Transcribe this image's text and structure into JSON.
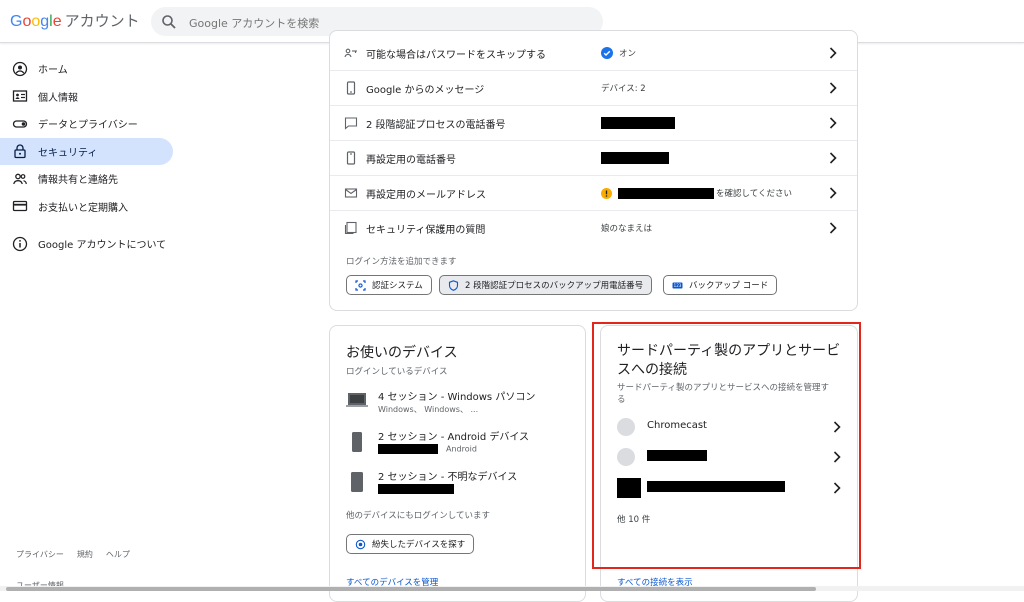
{
  "header": {
    "logo_text": "Google",
    "product_name": "アカウント",
    "search_placeholder": "Google アカウントを検索"
  },
  "sidebar": {
    "items": [
      {
        "label": "ホーム",
        "icon": "home-icon",
        "active": false
      },
      {
        "label": "個人情報",
        "icon": "id-card-icon",
        "active": false
      },
      {
        "label": "データとプライバシー",
        "icon": "toggle-icon",
        "active": false
      },
      {
        "label": "セキュリティ",
        "icon": "lock-icon",
        "active": true
      },
      {
        "label": "情報共有と連絡先",
        "icon": "people-icon",
        "active": false
      },
      {
        "label": "お支払いと定期購入",
        "icon": "credit-card-icon",
        "active": false
      }
    ],
    "about": {
      "label": "Google アカウントについて",
      "icon": "info-icon"
    },
    "footer_links": [
      "プライバシー",
      "規約",
      "ヘルプ"
    ],
    "user_info": "ユーザー情報"
  },
  "signin_methods": {
    "rows": [
      {
        "label": "可能な場合はパスワードをスキップする",
        "value": "オン",
        "status": "on",
        "icon": "passkey-icon"
      },
      {
        "label": "Google からのメッセージ",
        "value": "デバイス: 2",
        "icon": "phone-icon"
      },
      {
        "label": "2 段階認証プロセスの電話番号",
        "value": "",
        "redacted": true,
        "icon": "message-icon"
      },
      {
        "label": "再設定用の電話番号",
        "value": "",
        "redacted": true,
        "icon": "phone-outline-icon"
      },
      {
        "label": "再設定用のメールアドレス",
        "value": "を確認してください",
        "redacted": true,
        "status": "warning",
        "icon": "mail-icon"
      },
      {
        "label": "セキュリティ保護用の質問",
        "value": "娘のなまえは",
        "icon": "question-icon"
      }
    ],
    "add_note": "ログイン方法を追加できます",
    "chips": [
      {
        "label": "認証システム",
        "icon": "authenticator-icon"
      },
      {
        "label": "2 段階認証プロセスのバックアップ用電話番号",
        "icon": "shield-icon"
      },
      {
        "label": "バックアップ コード",
        "icon": "backup-code-icon"
      }
    ]
  },
  "devices": {
    "title": "お使いのデバイス",
    "subtitle": "ログインしているデバイス",
    "items": [
      {
        "title": "4 セッション - Windows パソコン",
        "detail": "Windows、 Windows、 ...",
        "icon": "laptop-icon"
      },
      {
        "title": "2 セッション - Android デバイス",
        "detail": "Android",
        "icon": "android-phone-icon"
      },
      {
        "title": "2 セッション - 不明なデバイス",
        "detail": "",
        "icon": "unknown-device-icon"
      }
    ],
    "other_note": "他のデバイスにもログインしています",
    "find_button": "紛失したデバイスを探す",
    "manage_link": "すべてのデバイスを管理"
  },
  "third_party": {
    "title": "サードパーティ製のアプリとサービスへの接続",
    "title_line1": "サードパーティ製のアプリとサービ",
    "title_line2": "スへの接続",
    "subtitle_line1": "サードパーティ製のアプリとサービスへの接続を管理す",
    "subtitle_line2": "る",
    "items": [
      {
        "label": "Chromecast"
      },
      {
        "label": "",
        "redacted": true
      },
      {
        "label": "",
        "redacted": true
      }
    ],
    "more": "他 10 件",
    "show_all_link": "すべての接続を表示"
  },
  "colors": {
    "active_nav_bg": "#d3e3fd",
    "link_blue": "#0b57d0",
    "on_check": "#1a73e8",
    "warning": "#f9ab00",
    "highlight_red": "#e1261c"
  }
}
